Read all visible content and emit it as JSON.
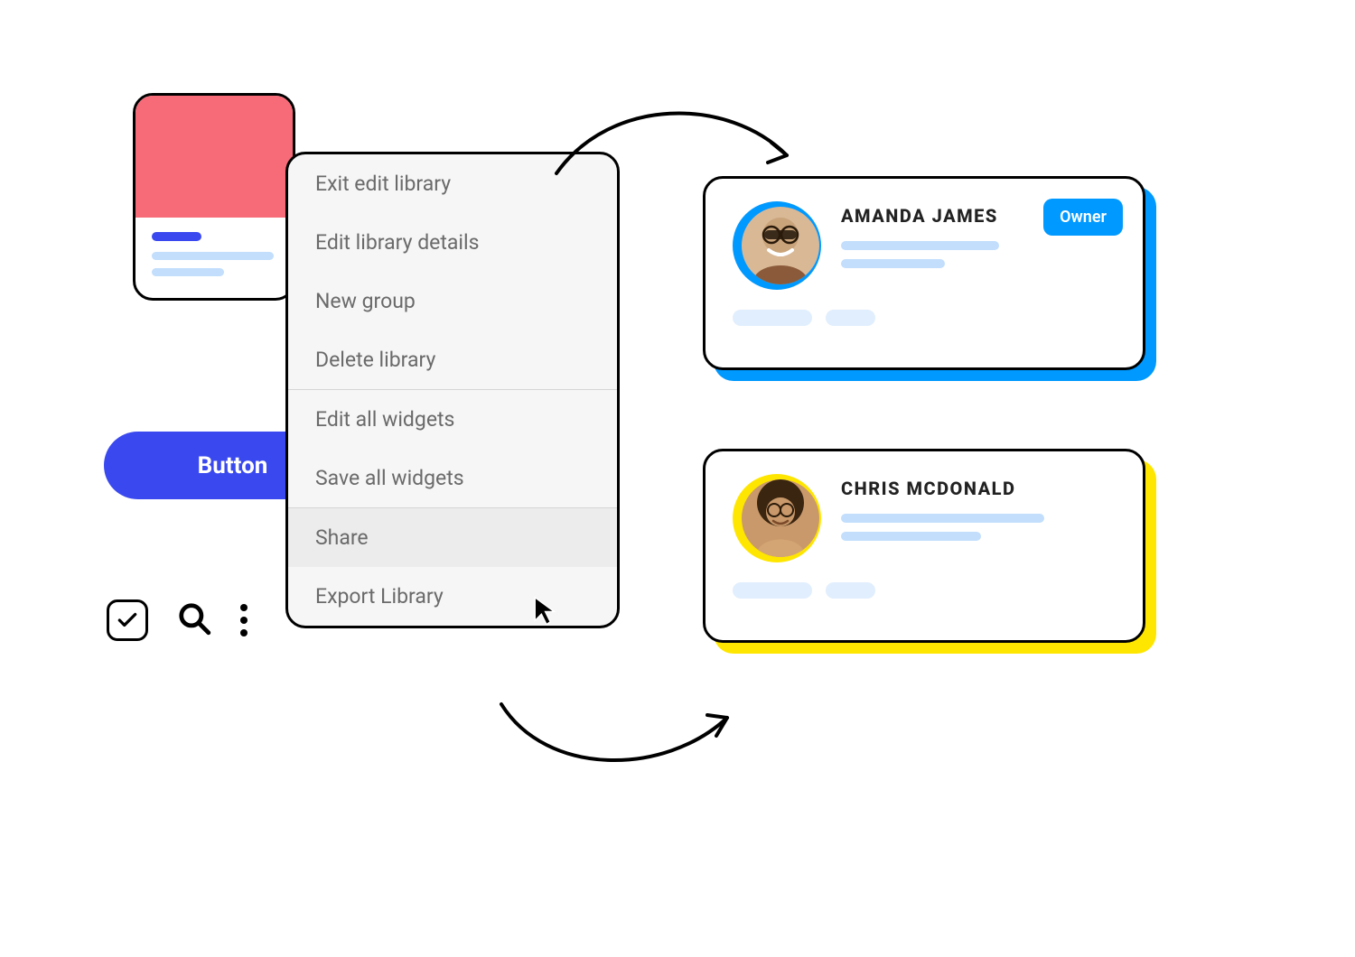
{
  "button_label": "Button",
  "menu": {
    "groups": [
      [
        "Exit edit library",
        "Edit library details",
        "New group",
        "Delete library"
      ],
      [
        "Edit all widgets",
        "Save all widgets"
      ],
      [
        "Share",
        "Export Library"
      ]
    ],
    "highlighted": "Share"
  },
  "users": [
    {
      "name": "AMANDA JAMES",
      "badge": "Owner",
      "accent": "#0099ff"
    },
    {
      "name": "CHRIS MCDONALD",
      "badge": null,
      "accent": "#ffe600"
    }
  ]
}
